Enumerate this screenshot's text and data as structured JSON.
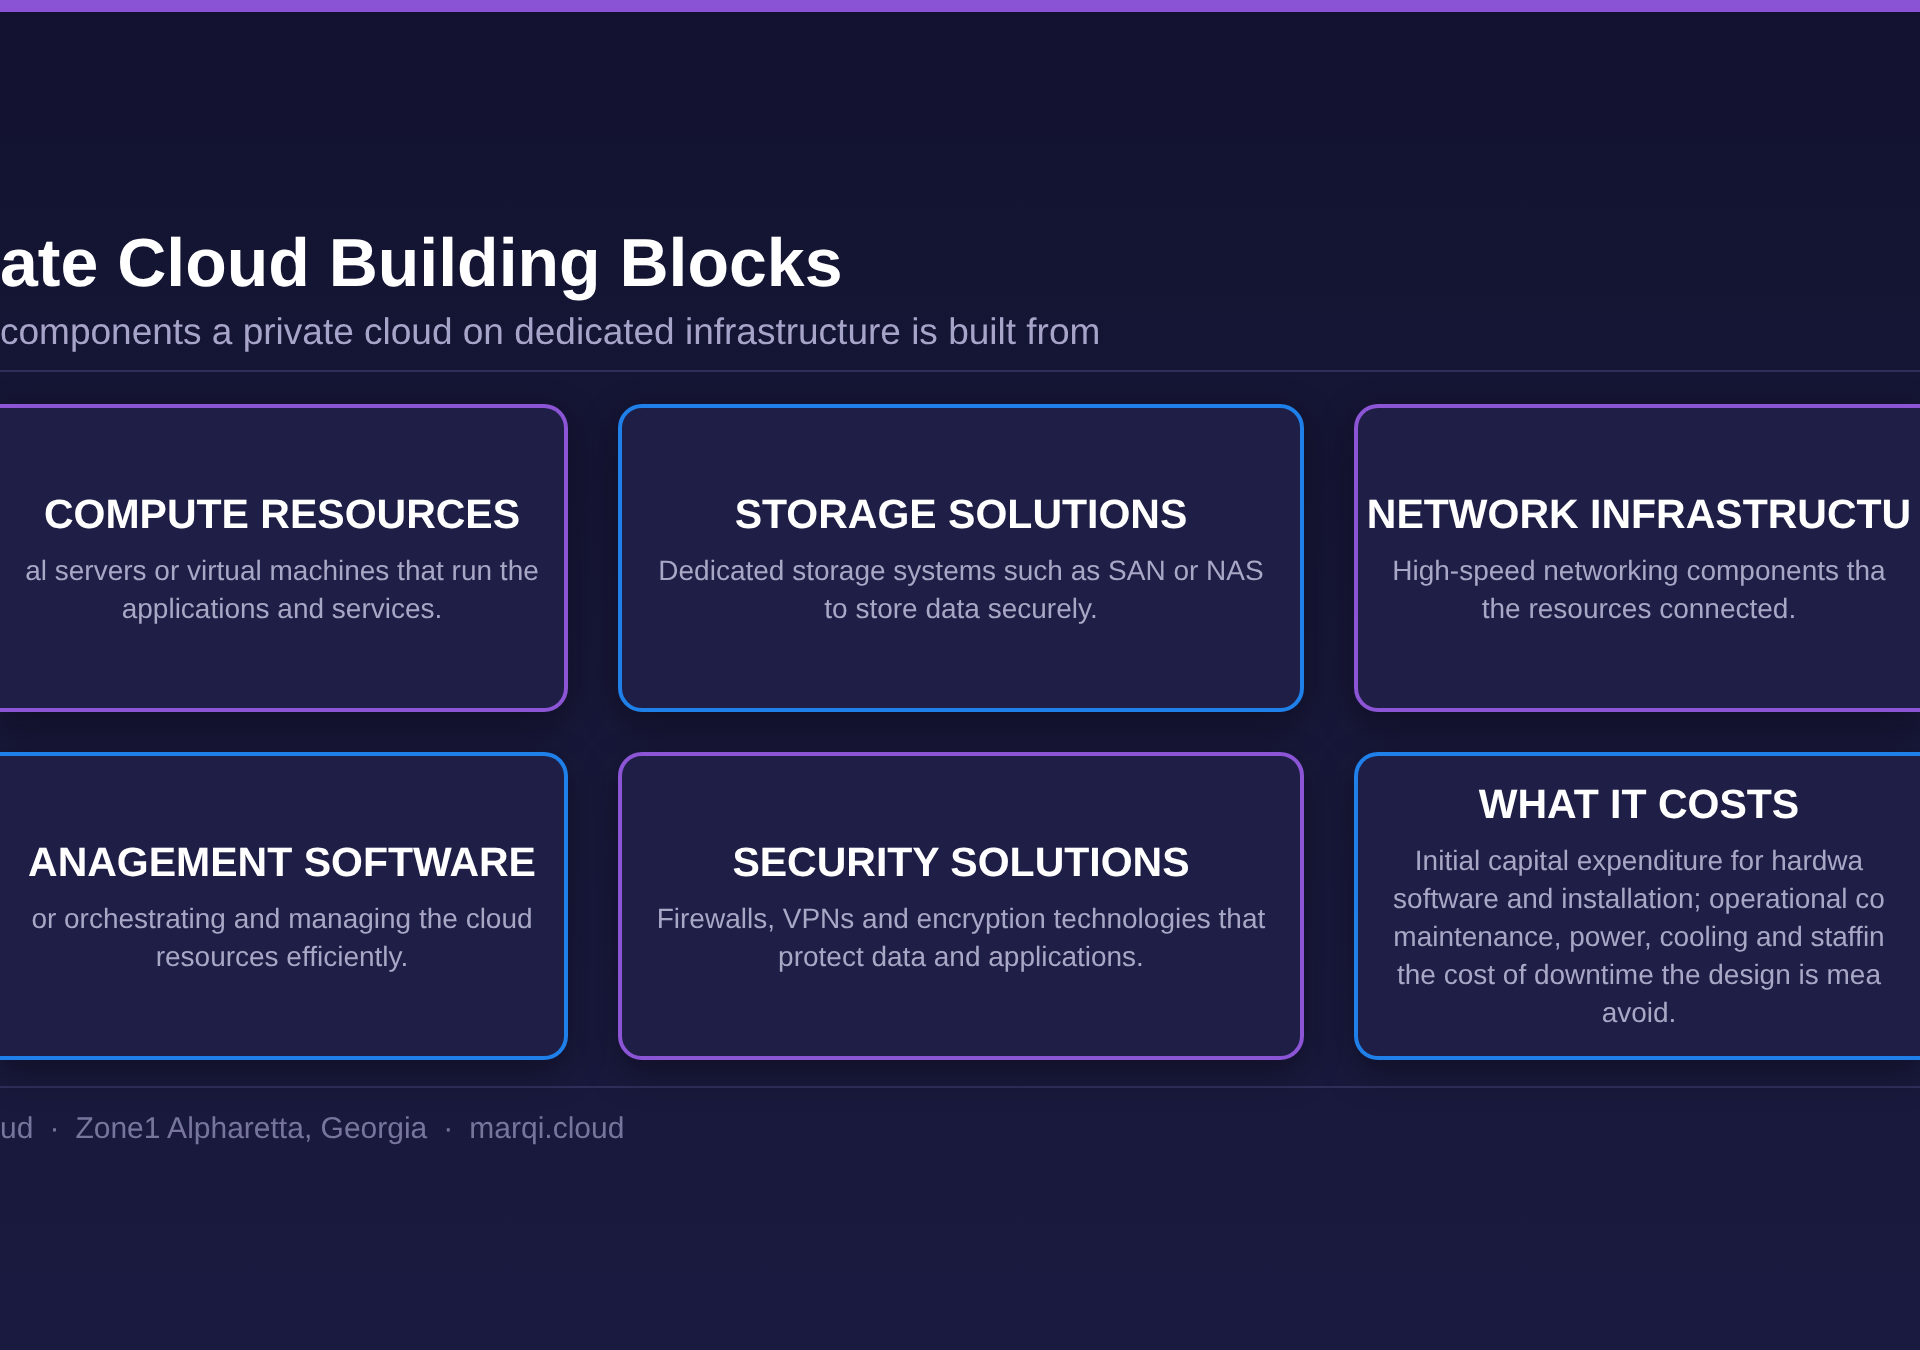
{
  "header": {
    "title": "ate Cloud Building Blocks",
    "subtitle": "components a private cloud on dedicated infrastructure is built from"
  },
  "cards": [
    {
      "title": "COMPUTE RESOURCES",
      "description": "al servers or virtual machines that run the\napplications and services.",
      "color": "#8b55d6"
    },
    {
      "title": "STORAGE SOLUTIONS",
      "description": "Dedicated storage systems such as SAN or NAS\nto store data securely.",
      "color": "#1f80ea"
    },
    {
      "title": "NETWORK INFRASTRUCTU",
      "description": "High-speed networking components tha\nthe resources connected.",
      "color": "#8b55d6"
    },
    {
      "title": "ANAGEMENT SOFTWARE",
      "description": "or orchestrating and managing the cloud\nresources efficiently.",
      "color": "#1f80ea"
    },
    {
      "title": "SECURITY SOLUTIONS",
      "description": "Firewalls, VPNs and encryption technologies that\nprotect data and applications.",
      "color": "#8b55d6"
    },
    {
      "title": "WHAT IT COSTS",
      "description": "Initial capital expenditure for hardwa\nsoftware and installation; operational co\nmaintenance, power, cooling and staffin\nthe cost of downtime the design is mea\navoid.",
      "color": "#1f80ea"
    }
  ],
  "footer": {
    "items": [
      "ud",
      "·",
      "Zone1 Alpharetta, Georgia",
      "·",
      "marqi.cloud"
    ]
  }
}
